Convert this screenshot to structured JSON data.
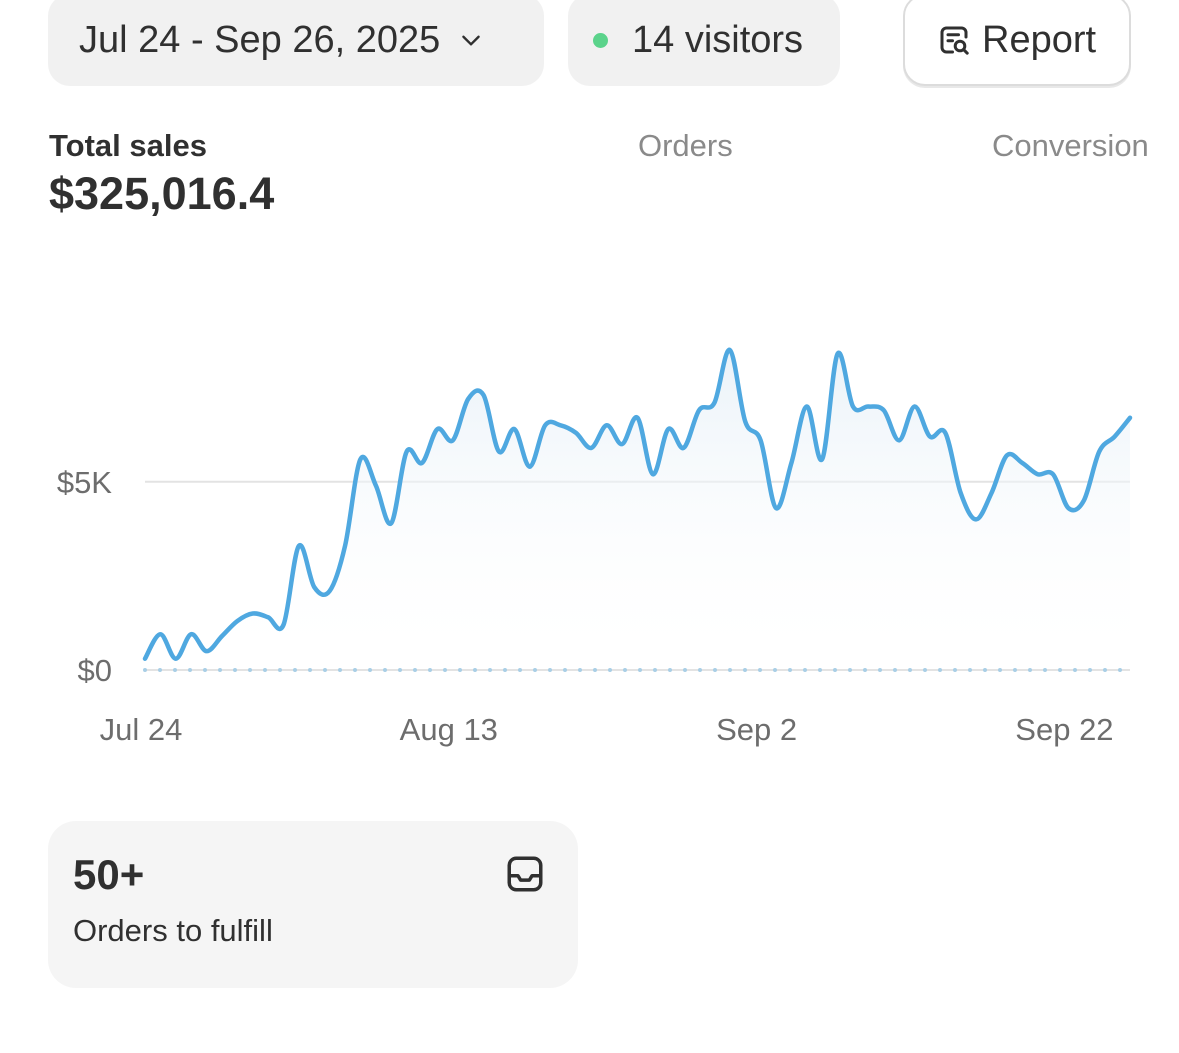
{
  "toolbar": {
    "date_range_label": "Jul 24 - Sep 26, 2025",
    "visitors_label": "14 visitors",
    "report_label": "Report",
    "live_dot_color": "#5bd38b"
  },
  "metrics": {
    "total_sales_label": "Total sales",
    "total_sales_value": "$325,016.4",
    "orders_label": "Orders",
    "conversion_label": "Conversion"
  },
  "chart_data": {
    "type": "line",
    "line_color": "#4fa8e0",
    "y_ticks": [
      {
        "value": 0,
        "label": "$0"
      },
      {
        "value": 5000,
        "label": "$5K"
      }
    ],
    "x_ticks": [
      {
        "index": 0,
        "label": "Jul 24"
      },
      {
        "index": 20,
        "label": "Aug 13"
      },
      {
        "index": 40,
        "label": "Sep 2"
      },
      {
        "index": 60,
        "label": "Sep 22"
      }
    ],
    "ylim": [
      0,
      8500
    ],
    "x": [
      "Jul 24",
      "Jul 25",
      "Jul 26",
      "Jul 27",
      "Jul 28",
      "Jul 29",
      "Jul 30",
      "Jul 31",
      "Aug 1",
      "Aug 2",
      "Aug 3",
      "Aug 4",
      "Aug 5",
      "Aug 6",
      "Aug 7",
      "Aug 8",
      "Aug 9",
      "Aug 10",
      "Aug 11",
      "Aug 12",
      "Aug 13",
      "Aug 14",
      "Aug 15",
      "Aug 16",
      "Aug 17",
      "Aug 18",
      "Aug 19",
      "Aug 20",
      "Aug 21",
      "Aug 22",
      "Aug 23",
      "Aug 24",
      "Aug 25",
      "Aug 26",
      "Aug 27",
      "Aug 28",
      "Aug 29",
      "Aug 30",
      "Aug 31",
      "Sep 1",
      "Sep 2",
      "Sep 3",
      "Sep 4",
      "Sep 5",
      "Sep 6",
      "Sep 7",
      "Sep 8",
      "Sep 9",
      "Sep 10",
      "Sep 11",
      "Sep 12",
      "Sep 13",
      "Sep 14",
      "Sep 15",
      "Sep 16",
      "Sep 17",
      "Sep 18",
      "Sep 19",
      "Sep 20",
      "Sep 21",
      "Sep 22",
      "Sep 23",
      "Sep 24",
      "Sep 25",
      "Sep 26"
    ],
    "series": [
      {
        "values": [
          300,
          950,
          300,
          950,
          500,
          900,
          1300,
          1500,
          1400,
          1200,
          3300,
          2200,
          2100,
          3300,
          5600,
          4900,
          3900,
          5800,
          5500,
          6400,
          6100,
          7200,
          7300,
          5800,
          6400,
          5400,
          6500,
          6500,
          6300,
          5900,
          6500,
          6000,
          6700,
          5200,
          6400,
          5900,
          6900,
          7100,
          8500,
          6600,
          6100,
          4300,
          5500,
          7000,
          5600,
          8400,
          7000,
          7000,
          6900,
          6100,
          7000,
          6200,
          6300,
          4700,
          4000,
          4700,
          5700,
          5500,
          5200,
          5200,
          4300,
          4500,
          5800,
          6200,
          6700
        ]
      }
    ]
  },
  "fulfill_card": {
    "count": "50+",
    "label": "Orders to fulfill"
  }
}
